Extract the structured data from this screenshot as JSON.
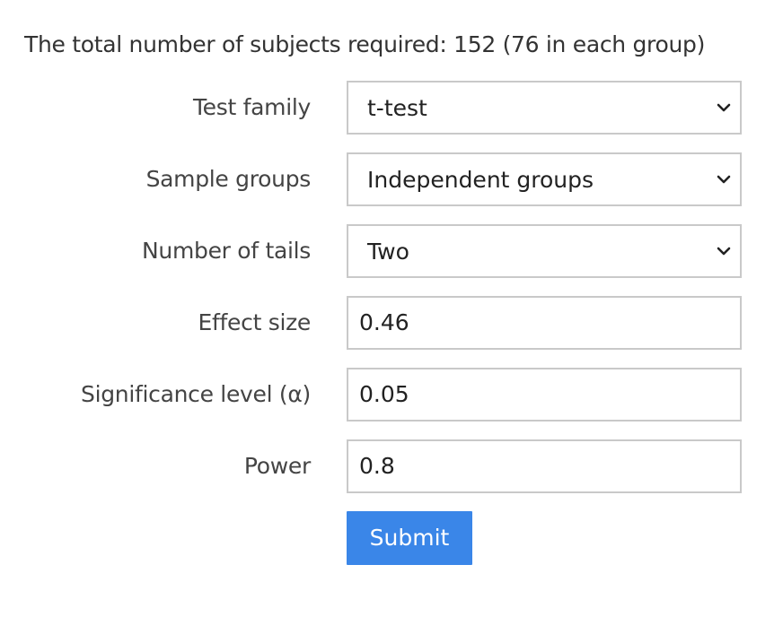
{
  "result": {
    "text": "The total number of subjects required: 152 (76 in each group)"
  },
  "form": {
    "test_family": {
      "label": "Test family",
      "value": "t-test",
      "icon": "chevron-down-icon"
    },
    "sample_groups": {
      "label": "Sample groups",
      "value": "Independent groups",
      "icon": "chevron-down-icon"
    },
    "number_of_tails": {
      "label": "Number of tails",
      "value": "Two",
      "icon": "chevron-down-icon"
    },
    "effect_size": {
      "label": "Effect size",
      "value": "0.46"
    },
    "significance_level": {
      "label": "Significance level (α)",
      "value": "0.05"
    },
    "power": {
      "label": "Power",
      "value": "0.8"
    }
  },
  "actions": {
    "submit_label": "Submit",
    "submit_color": "#3a86e8"
  }
}
